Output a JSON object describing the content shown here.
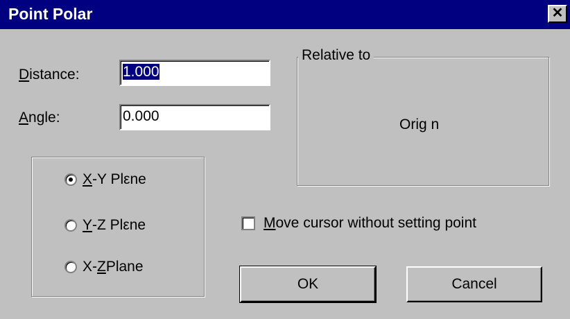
{
  "window": {
    "title": "Point Polar",
    "close_glyph": "✕"
  },
  "distance": {
    "mnemonic": "D",
    "label_rest": "istance:",
    "value": "1.000"
  },
  "angle": {
    "mnemonic": "A",
    "label_rest": "ngle:",
    "value": "0.000"
  },
  "relative": {
    "legend": "Relative to",
    "value": "Orig n"
  },
  "planes": [
    {
      "pre": "",
      "mnemonic": "X",
      "post": "-Y Plεne",
      "selected": true
    },
    {
      "pre": "",
      "mnemonic": "Y",
      "post": "-Z Plεne",
      "selected": false
    },
    {
      "pre": "X-",
      "mnemonic": "Z",
      "post": " Plane",
      "selected": false
    }
  ],
  "move_cursor": {
    "mnemonic": "M",
    "label_rest": "ove cursor without setting point",
    "checked": false
  },
  "buttons": {
    "ok": "OK",
    "cancel": "Cancel"
  }
}
